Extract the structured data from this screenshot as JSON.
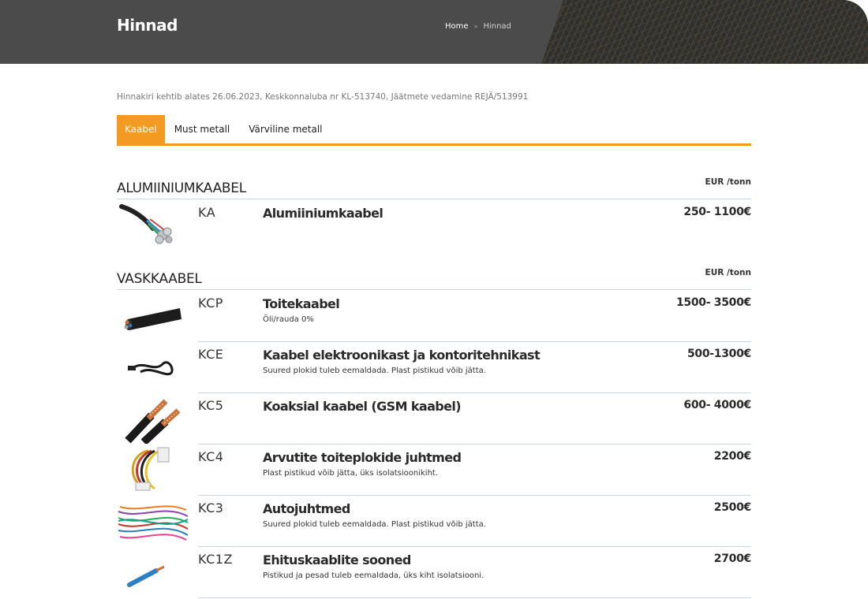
{
  "header": {
    "title": "Hinnad",
    "breadcrumb": {
      "home": "Home",
      "separator": "»",
      "current": "Hinnad"
    }
  },
  "notice": "Hinnakiri kehtib alates 26.06.2023, Keskkonnaluba nr KL-513740, Jäätmete vedamine REJÄ/513991",
  "tabs": [
    {
      "label": "Kaabel",
      "active": true
    },
    {
      "label": "Must metall",
      "active": false
    },
    {
      "label": "Värviline metall",
      "active": false
    }
  ],
  "colors": {
    "accent": "#f29a22",
    "header_bg": "#4b4b4b",
    "divider": "#c8d6e5"
  },
  "sections": [
    {
      "title": "ALUMIINIUMKAABEL",
      "unit": "EUR /tonn",
      "items": [
        {
          "code": "KA",
          "name": "Alumiiniumkaabel",
          "note": "",
          "price": "250- 1100€",
          "icon": "aluminium-cable-icon"
        }
      ]
    },
    {
      "title": "VASKKAABEL",
      "unit": "EUR /tonn",
      "items": [
        {
          "code": "KCP",
          "name": "Toitekaabel",
          "note": "Õli/rauda 0%",
          "price": "1500- 3500€",
          "icon": "power-cable-icon"
        },
        {
          "code": "KCE",
          "name": "Kaabel elektroonikast ja kontoritehnikast",
          "note": "Suured plokid tuleb eemaldada. Plast pistikud võib jätta.",
          "price": "500-1300€",
          "icon": "electronics-cable-icon"
        },
        {
          "code": "KC5",
          "name": "Koaksial kaabel (GSM kaabel)",
          "note": "",
          "price": "600- 4000€",
          "icon": "coaxial-cable-icon"
        },
        {
          "code": "KC4",
          "name": "Arvutite toiteplokide juhtmed",
          "note": "Plast pistikud võib jätta, üks isolatsioonikiht.",
          "price": "2200€",
          "icon": "psu-wires-icon"
        },
        {
          "code": "KC3",
          "name": "Autojuhtmed",
          "note": "Suured plokid tuleb eemaldada. Plast pistikud võib jätta.",
          "price": "2500€",
          "icon": "car-wires-icon"
        },
        {
          "code": "KC1Z",
          "name": "Ehituskaablite sooned",
          "note": "Pistikud ja pesad tuleb eemaldada, üks kiht isolatsiooni.",
          "price": "2700€",
          "icon": "building-wire-icon"
        }
      ]
    }
  ]
}
